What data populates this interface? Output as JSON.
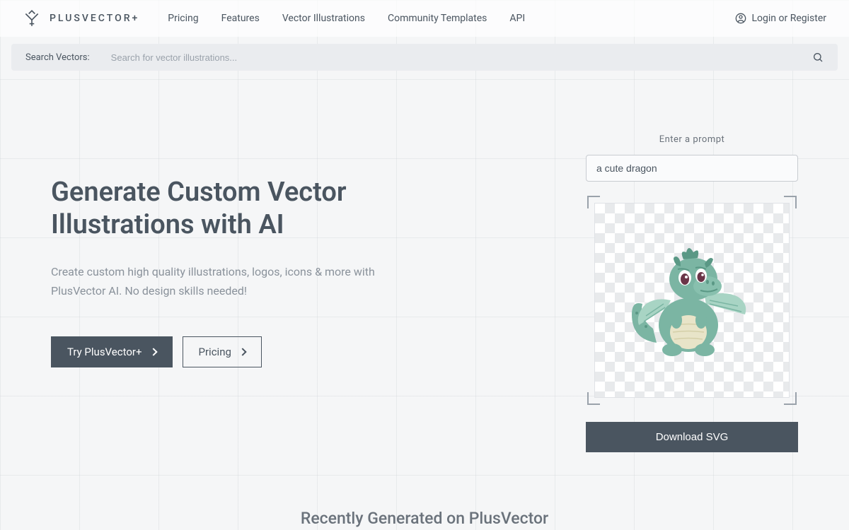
{
  "brand": {
    "name": "PLUSVECTOR+"
  },
  "nav": {
    "links": [
      "Pricing",
      "Features",
      "Vector Illustrations",
      "Community Templates",
      "API"
    ],
    "login": "Login or Register"
  },
  "search": {
    "label": "Search Vectors:",
    "placeholder": "Search for vector illustrations..."
  },
  "hero": {
    "title": "Generate Custom Vector Illustrations with AI",
    "subtitle": "Create custom high quality illustrations, logos, icons & more with PlusVector AI. No design skills needed!",
    "cta_primary": "Try PlusVector+",
    "cta_secondary": "Pricing"
  },
  "generator": {
    "prompt_label": "Enter a prompt",
    "prompt_value": "a cute dragon",
    "download_label": "Download SVG"
  },
  "recently_title": "Recently Generated on PlusVector"
}
